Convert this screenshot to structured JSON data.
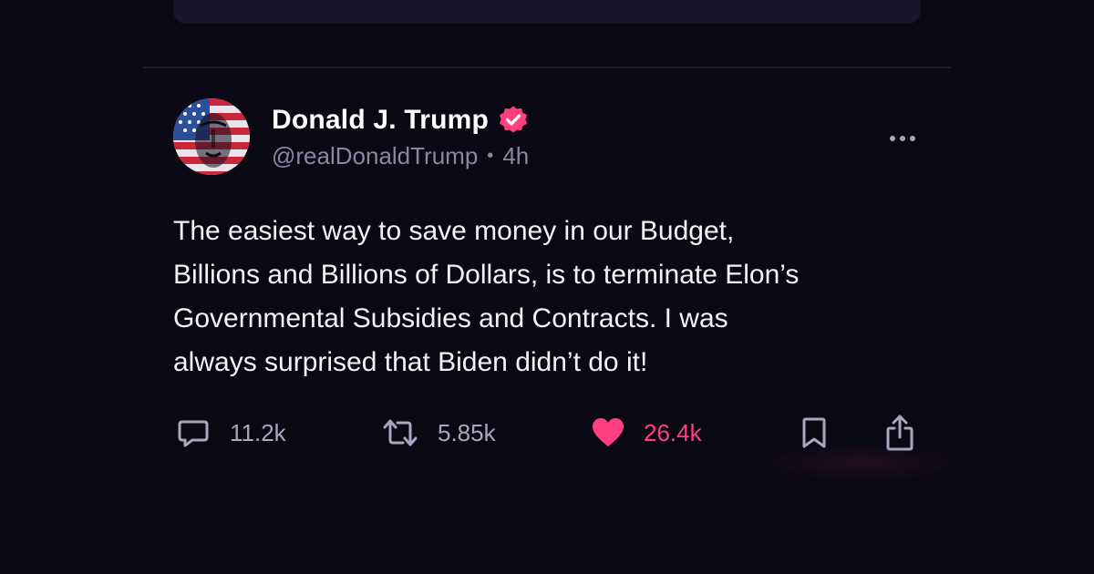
{
  "post": {
    "author": {
      "display_name": "Donald J. Trump",
      "handle": "@realDonaldTrump",
      "separator": "•",
      "time_ago": "4h",
      "verified": true
    },
    "text": "The easiest way to save money in our Budget,\nBillions and Billions of Dollars, is to terminate Elon’s\nGovernmental Subsidies and Contracts. I was\nalways surprised that Biden didn’t do it!",
    "actions": {
      "reply_count": "11.2k",
      "repost_count": "5.85k",
      "like_count": "26.4k",
      "liked": true
    }
  },
  "icons": {
    "verified": "verified-badge-icon",
    "more": "more-options-icon",
    "reply": "reply-icon",
    "repost": "repost-icon",
    "like": "heart-icon",
    "bookmark": "bookmark-icon",
    "share": "share-icon"
  },
  "colors": {
    "background": "#0b0816",
    "accent": "#ff3f7f",
    "text_primary": "#f3f2f8",
    "text_secondary": "#8a87a3"
  }
}
